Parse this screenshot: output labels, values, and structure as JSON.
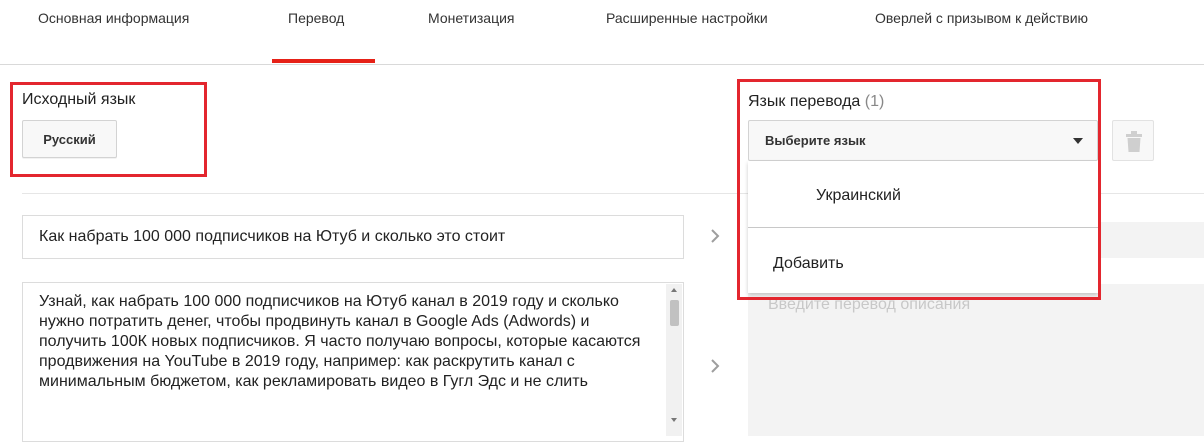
{
  "tabs": [
    {
      "label": "Основная информация",
      "active": false
    },
    {
      "label": "Перевод",
      "active": true
    },
    {
      "label": "Монетизация",
      "active": false
    },
    {
      "label": "Расширенные настройки",
      "active": false
    },
    {
      "label": "Оверлей с призывом к действию",
      "active": false
    }
  ],
  "source": {
    "label": "Исходный язык",
    "language": "Русский"
  },
  "target": {
    "label": "Язык перевода",
    "count": "(1)",
    "select_placeholder": "Выберите язык",
    "menu_items": [
      "Украинский"
    ],
    "add_label": "Добавить",
    "description_placeholder": "Введите перевод описания"
  },
  "video": {
    "title": "Как набрать 100 000 подписчиков на Ютуб и сколько это стоит",
    "description": "Узнай, как набрать 100 000 подписчиков на Ютуб канал в 2019 году и сколько нужно потратить денег, чтобы продвинуть канал в Google Ads (Adwords) и получить 100К новых подписчиков. Я часто получаю вопросы, которые касаются продвижения на YouTube в 2019 году, например: как раскрутить канал с минимальным бюджетом, как рекламировать видео в Гугл Эдс и не слить"
  },
  "icons": {
    "caret": "caret-down-icon",
    "trash": "trash-icon",
    "copy_arrow": "chevron-right-icon"
  },
  "colors": {
    "accent_red": "#e62117",
    "highlight_red": "#e3262e",
    "placeholder_gray": "#c8c8c8"
  }
}
